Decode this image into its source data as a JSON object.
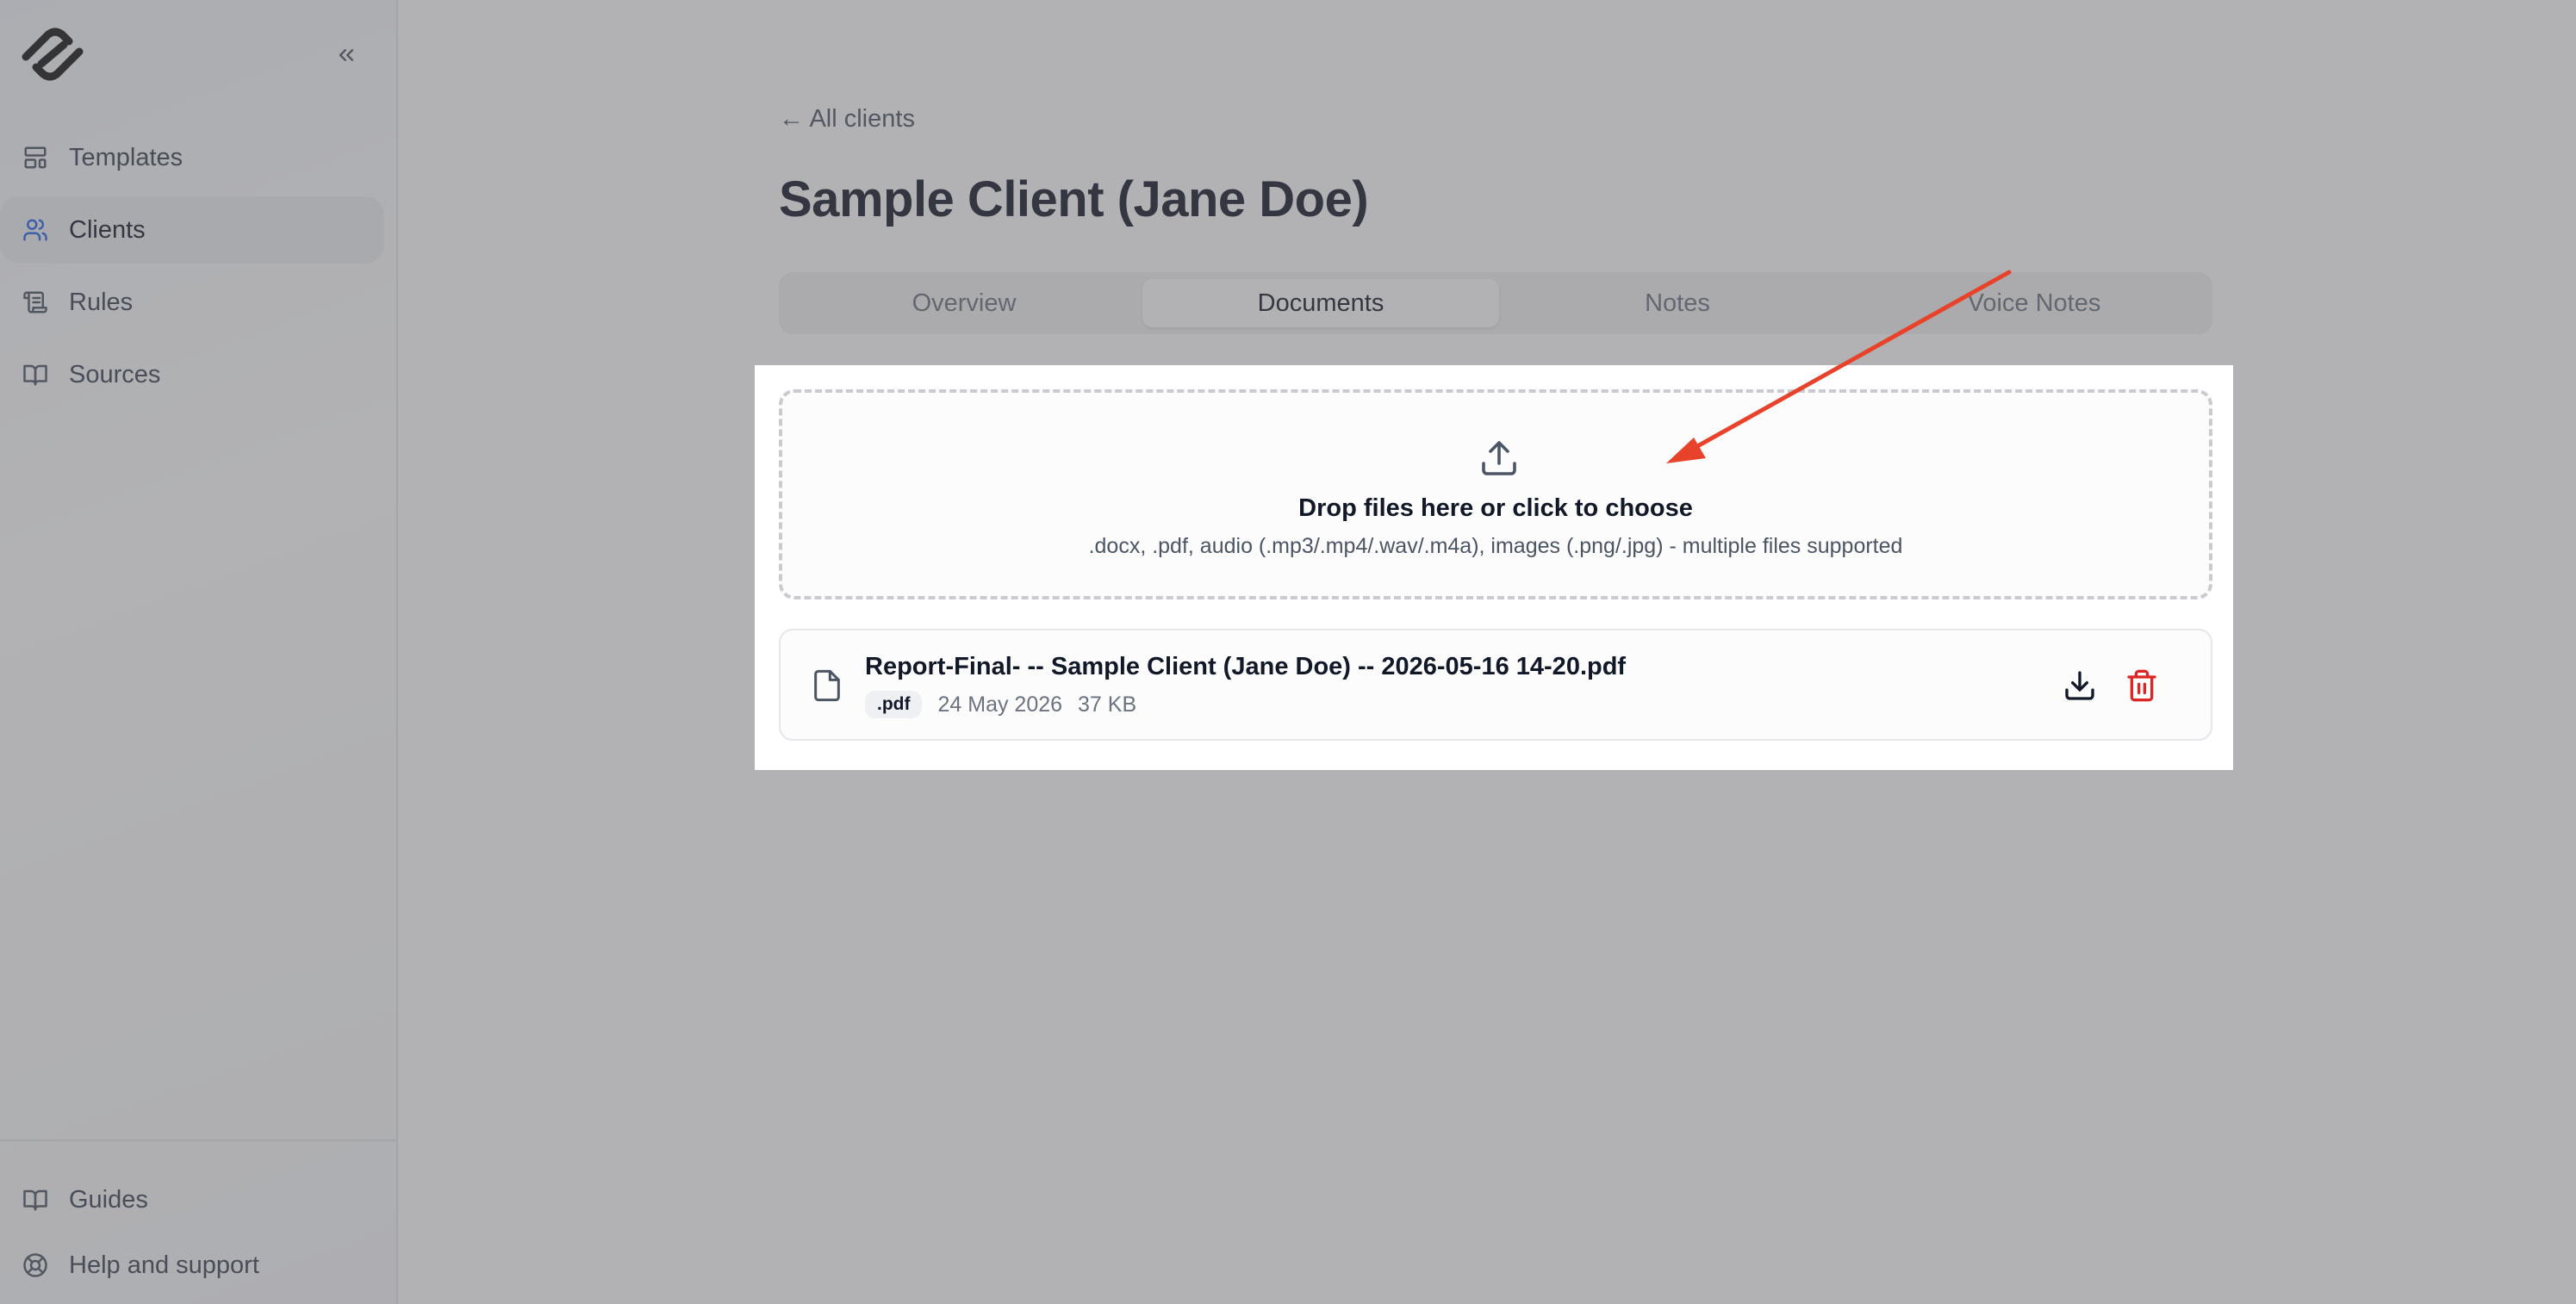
{
  "sidebar": {
    "items": [
      {
        "label": "Templates",
        "icon": "layout-template-icon"
      },
      {
        "label": "Clients",
        "icon": "users-icon"
      },
      {
        "label": "Rules",
        "icon": "scroll-icon"
      },
      {
        "label": "Sources",
        "icon": "book-open-icon"
      }
    ],
    "active_index": 1,
    "bottom_items": [
      {
        "label": "Guides",
        "icon": "book-open-icon"
      },
      {
        "label": "Help and support",
        "icon": "life-buoy-icon"
      }
    ],
    "collapse_icon": "chevrons-left-icon"
  },
  "main": {
    "back_link": "← All clients",
    "title": "Sample Client (Jane Doe)",
    "tabs": [
      {
        "label": "Overview"
      },
      {
        "label": "Documents"
      },
      {
        "label": "Notes"
      },
      {
        "label": "Voice Notes"
      }
    ],
    "active_tab": 1,
    "dropzone": {
      "title": "Drop files here or click to choose",
      "subtitle": ".docx, .pdf, audio (.mp3/.mp4/.wav/.m4a), images (.png/.jpg) - multiple files supported"
    },
    "files": [
      {
        "name": "Report-Final- -- Sample Client (Jane Doe) -- 2026-05-16 14-20.pdf",
        "type_badge": ".pdf",
        "date": "24 May 2026",
        "size": "37 KB"
      }
    ]
  },
  "colors": {
    "accent": "#2563eb",
    "delete": "#dc2626",
    "annotation_arrow": "#e8432a"
  }
}
